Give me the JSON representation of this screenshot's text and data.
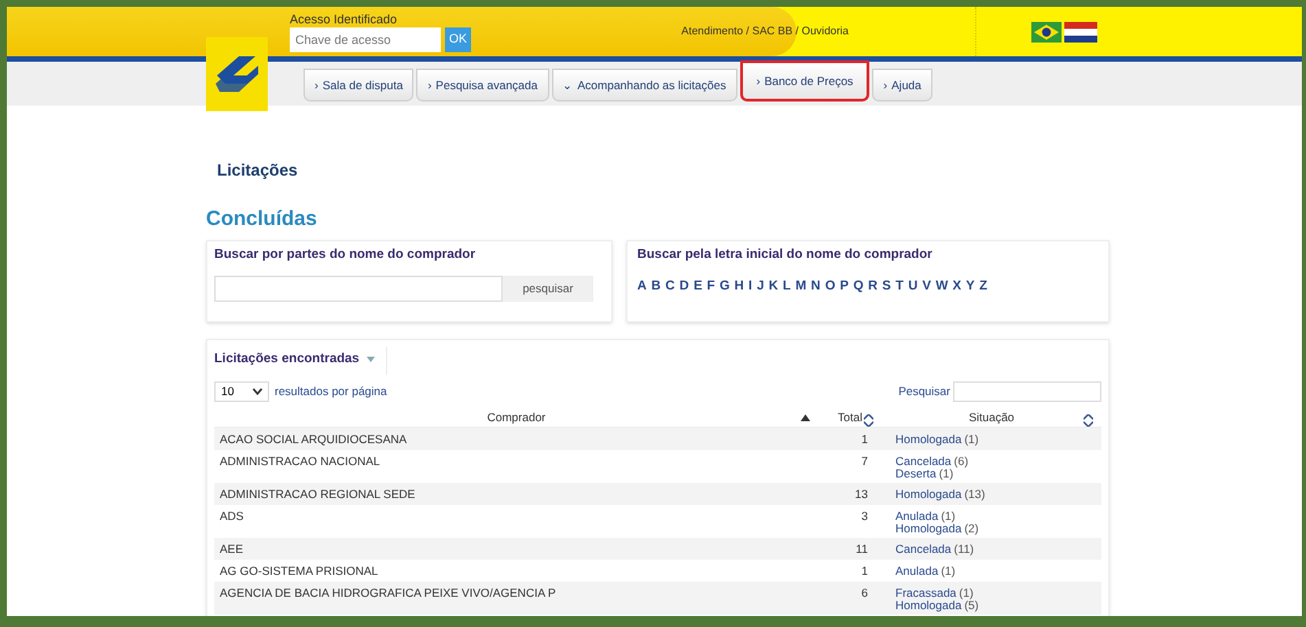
{
  "header": {
    "access_label": "Acesso Identificado",
    "access_field": {
      "placeholder": "Chave de acesso"
    },
    "ok_button": "OK",
    "service_link": "Atendimento / SAC BB / Ouvidoria"
  },
  "nav": [
    {
      "label": "Sala de disputa",
      "arrow": "›",
      "highlighted": false
    },
    {
      "label": "Pesquisa avançada",
      "arrow": "›",
      "highlighted": false
    },
    {
      "label": "Acompanhando as licitações",
      "arrow": "⌄",
      "highlighted": false
    },
    {
      "label": "Banco de Preços",
      "arrow": "›",
      "highlighted": true
    },
    {
      "label": "Ajuda",
      "arrow": "›",
      "highlighted": false
    }
  ],
  "page_title": "Licitações",
  "section_title": "Concluídas",
  "search_by_name": {
    "title": "Buscar por partes do nome do comprador",
    "button": "pesquisar"
  },
  "search_by_letter": {
    "title": "Buscar pela letra inicial do nome do comprador",
    "letters": [
      "A",
      "B",
      "C",
      "D",
      "E",
      "F",
      "G",
      "H",
      "I",
      "J",
      "K",
      "L",
      "M",
      "N",
      "O",
      "P",
      "Q",
      "R",
      "S",
      "T",
      "U",
      "V",
      "W",
      "X",
      "Y",
      "Z"
    ]
  },
  "results": {
    "tab": "Licitações encontradas",
    "page_size": "10",
    "page_size_label": "resultados por página",
    "search_label": "Pesquisar",
    "columns": [
      {
        "label": "Comprador",
        "sorted": true
      },
      {
        "label": "Total",
        "sorted": false
      },
      {
        "label": "Situação",
        "sorted": false
      }
    ],
    "rows": [
      {
        "buyer": "ACAO SOCIAL ARQUIDIOCESANA",
        "total": "1",
        "statuses": [
          {
            "label": "Homologada",
            "count": "(1)"
          }
        ]
      },
      {
        "buyer": "ADMINISTRACAO NACIONAL",
        "total": "7",
        "statuses": [
          {
            "label": "Cancelada",
            "count": "(6)"
          },
          {
            "label": "Deserta",
            "count": "(1)"
          }
        ]
      },
      {
        "buyer": "ADMINISTRACAO REGIONAL SEDE",
        "total": "13",
        "statuses": [
          {
            "label": "Homologada",
            "count": "(13)"
          }
        ]
      },
      {
        "buyer": "ADS",
        "total": "3",
        "statuses": [
          {
            "label": "Anulada",
            "count": "(1)"
          },
          {
            "label": "Homologada",
            "count": "(2)"
          }
        ]
      },
      {
        "buyer": "AEE",
        "total": "11",
        "statuses": [
          {
            "label": "Cancelada",
            "count": "(11)"
          }
        ]
      },
      {
        "buyer": "AG GO-SISTEMA PRISIONAL",
        "total": "1",
        "statuses": [
          {
            "label": "Anulada",
            "count": "(1)"
          }
        ]
      },
      {
        "buyer": "AGENCIA DE BACIA HIDROGRAFICA PEIXE VIVO/AGENCIA P",
        "total": "6",
        "statuses": [
          {
            "label": "Fracassada",
            "count": "(1)"
          },
          {
            "label": "Homologada",
            "count": "(5)"
          }
        ]
      }
    ]
  }
}
